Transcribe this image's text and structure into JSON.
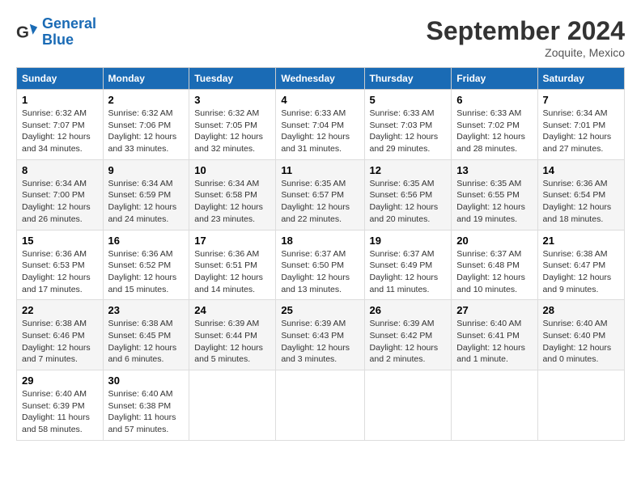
{
  "header": {
    "logo_line1": "General",
    "logo_line2": "Blue",
    "month": "September 2024",
    "location": "Zoquite, Mexico"
  },
  "columns": [
    "Sunday",
    "Monday",
    "Tuesday",
    "Wednesday",
    "Thursday",
    "Friday",
    "Saturday"
  ],
  "weeks": [
    [
      {
        "day": "1",
        "sunrise": "6:32 AM",
        "sunset": "7:07 PM",
        "daylight": "12 hours and 34 minutes."
      },
      {
        "day": "2",
        "sunrise": "6:32 AM",
        "sunset": "7:06 PM",
        "daylight": "12 hours and 33 minutes."
      },
      {
        "day": "3",
        "sunrise": "6:32 AM",
        "sunset": "7:05 PM",
        "daylight": "12 hours and 32 minutes."
      },
      {
        "day": "4",
        "sunrise": "6:33 AM",
        "sunset": "7:04 PM",
        "daylight": "12 hours and 31 minutes."
      },
      {
        "day": "5",
        "sunrise": "6:33 AM",
        "sunset": "7:03 PM",
        "daylight": "12 hours and 29 minutes."
      },
      {
        "day": "6",
        "sunrise": "6:33 AM",
        "sunset": "7:02 PM",
        "daylight": "12 hours and 28 minutes."
      },
      {
        "day": "7",
        "sunrise": "6:34 AM",
        "sunset": "7:01 PM",
        "daylight": "12 hours and 27 minutes."
      }
    ],
    [
      {
        "day": "8",
        "sunrise": "6:34 AM",
        "sunset": "7:00 PM",
        "daylight": "12 hours and 26 minutes."
      },
      {
        "day": "9",
        "sunrise": "6:34 AM",
        "sunset": "6:59 PM",
        "daylight": "12 hours and 24 minutes."
      },
      {
        "day": "10",
        "sunrise": "6:34 AM",
        "sunset": "6:58 PM",
        "daylight": "12 hours and 23 minutes."
      },
      {
        "day": "11",
        "sunrise": "6:35 AM",
        "sunset": "6:57 PM",
        "daylight": "12 hours and 22 minutes."
      },
      {
        "day": "12",
        "sunrise": "6:35 AM",
        "sunset": "6:56 PM",
        "daylight": "12 hours and 20 minutes."
      },
      {
        "day": "13",
        "sunrise": "6:35 AM",
        "sunset": "6:55 PM",
        "daylight": "12 hours and 19 minutes."
      },
      {
        "day": "14",
        "sunrise": "6:36 AM",
        "sunset": "6:54 PM",
        "daylight": "12 hours and 18 minutes."
      }
    ],
    [
      {
        "day": "15",
        "sunrise": "6:36 AM",
        "sunset": "6:53 PM",
        "daylight": "12 hours and 17 minutes."
      },
      {
        "day": "16",
        "sunrise": "6:36 AM",
        "sunset": "6:52 PM",
        "daylight": "12 hours and 15 minutes."
      },
      {
        "day": "17",
        "sunrise": "6:36 AM",
        "sunset": "6:51 PM",
        "daylight": "12 hours and 14 minutes."
      },
      {
        "day": "18",
        "sunrise": "6:37 AM",
        "sunset": "6:50 PM",
        "daylight": "12 hours and 13 minutes."
      },
      {
        "day": "19",
        "sunrise": "6:37 AM",
        "sunset": "6:49 PM",
        "daylight": "12 hours and 11 minutes."
      },
      {
        "day": "20",
        "sunrise": "6:37 AM",
        "sunset": "6:48 PM",
        "daylight": "12 hours and 10 minutes."
      },
      {
        "day": "21",
        "sunrise": "6:38 AM",
        "sunset": "6:47 PM",
        "daylight": "12 hours and 9 minutes."
      }
    ],
    [
      {
        "day": "22",
        "sunrise": "6:38 AM",
        "sunset": "6:46 PM",
        "daylight": "12 hours and 7 minutes."
      },
      {
        "day": "23",
        "sunrise": "6:38 AM",
        "sunset": "6:45 PM",
        "daylight": "12 hours and 6 minutes."
      },
      {
        "day": "24",
        "sunrise": "6:39 AM",
        "sunset": "6:44 PM",
        "daylight": "12 hours and 5 minutes."
      },
      {
        "day": "25",
        "sunrise": "6:39 AM",
        "sunset": "6:43 PM",
        "daylight": "12 hours and 3 minutes."
      },
      {
        "day": "26",
        "sunrise": "6:39 AM",
        "sunset": "6:42 PM",
        "daylight": "12 hours and 2 minutes."
      },
      {
        "day": "27",
        "sunrise": "6:40 AM",
        "sunset": "6:41 PM",
        "daylight": "12 hours and 1 minute."
      },
      {
        "day": "28",
        "sunrise": "6:40 AM",
        "sunset": "6:40 PM",
        "daylight": "12 hours and 0 minutes."
      }
    ],
    [
      {
        "day": "29",
        "sunrise": "6:40 AM",
        "sunset": "6:39 PM",
        "daylight": "11 hours and 58 minutes."
      },
      {
        "day": "30",
        "sunrise": "6:40 AM",
        "sunset": "6:38 PM",
        "daylight": "11 hours and 57 minutes."
      },
      null,
      null,
      null,
      null,
      null
    ]
  ]
}
